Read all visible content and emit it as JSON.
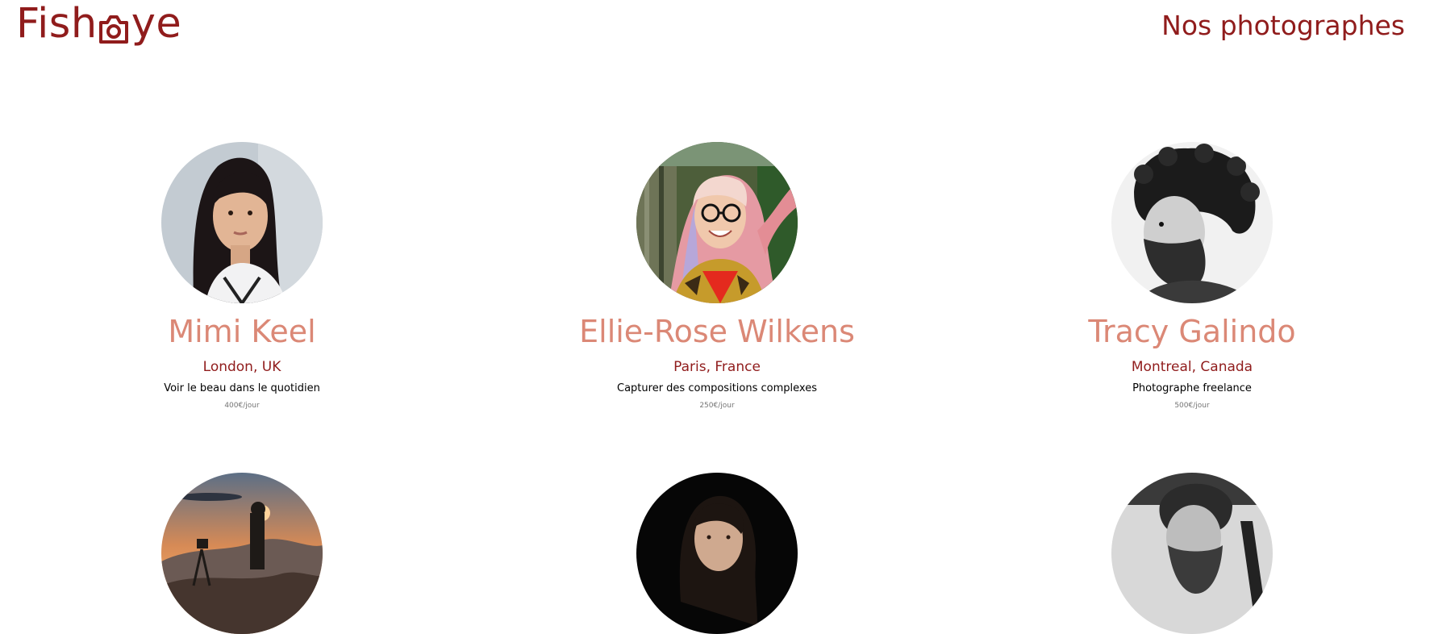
{
  "colors": {
    "brand": "#901C1C",
    "name": "#DB8876",
    "tagline": "#000000",
    "price": "#757575"
  },
  "header": {
    "logo_text_start": "Fish",
    "logo_icon": "camera-icon",
    "logo_text_end": "ye",
    "title": "Nos photographes"
  },
  "photographers": [
    {
      "name": "Mimi Keel",
      "location": "London, UK",
      "tagline": "Voir le beau dans le quotidien",
      "price": "400€/jour",
      "portrait_alt": "Mimi Keel"
    },
    {
      "name": "Ellie-Rose Wilkens",
      "location": "Paris, France",
      "tagline": "Capturer des compositions complexes",
      "price": "250€/jour",
      "portrait_alt": "Ellie-Rose Wilkens"
    },
    {
      "name": "Tracy Galindo",
      "location": "Montreal, Canada",
      "tagline": "Photographe freelance",
      "price": "500€/jour",
      "portrait_alt": "Tracy Galindo"
    },
    {
      "portrait_alt": ""
    },
    {
      "portrait_alt": ""
    },
    {
      "portrait_alt": ""
    }
  ]
}
